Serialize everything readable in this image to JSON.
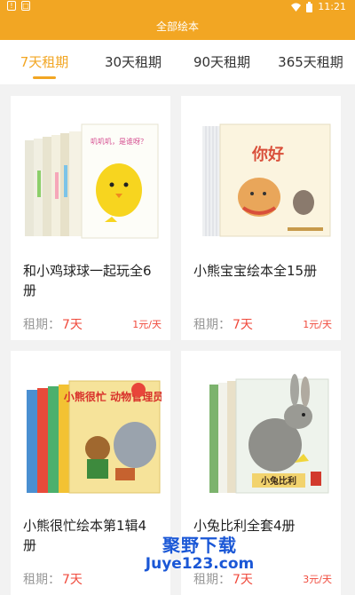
{
  "status_bar": {
    "time": "11:21",
    "left_icons": [
      "notification-icon",
      "app-icon"
    ],
    "right_icons": [
      "wifi-icon",
      "battery-icon"
    ]
  },
  "header": {
    "title": "全部绘本"
  },
  "tabs": [
    {
      "label": "7天租期",
      "active": true
    },
    {
      "label": "30天租期",
      "active": false
    },
    {
      "label": "90天租期",
      "active": false
    },
    {
      "label": "365天租期",
      "active": false
    }
  ],
  "books": [
    {
      "title": "和小鸡球球一起玩全6册",
      "term_label": "租期：",
      "term_value": "7天",
      "price": "1元/天",
      "cover_text": "叽叽叽，是谁呀？"
    },
    {
      "title": "小熊宝宝绘本全15册",
      "term_label": "租期：",
      "term_value": "7天",
      "price": "1元/天",
      "cover_text": "你好"
    },
    {
      "title": "小熊很忙绘本第1辑4册",
      "term_label": "租期：",
      "term_value": "7天",
      "price": "",
      "cover_text": "小熊很忙 动物管理员"
    },
    {
      "title": "小兔比利全套4册",
      "term_label": "租期：",
      "term_value": "7天",
      "price": "3元/天",
      "cover_text": "小兔比利"
    }
  ],
  "watermark": {
    "line1": "聚野下载",
    "line2": "Juye123.com"
  },
  "colors": {
    "accent": "#f2a623",
    "price_red": "#f04a3c"
  }
}
